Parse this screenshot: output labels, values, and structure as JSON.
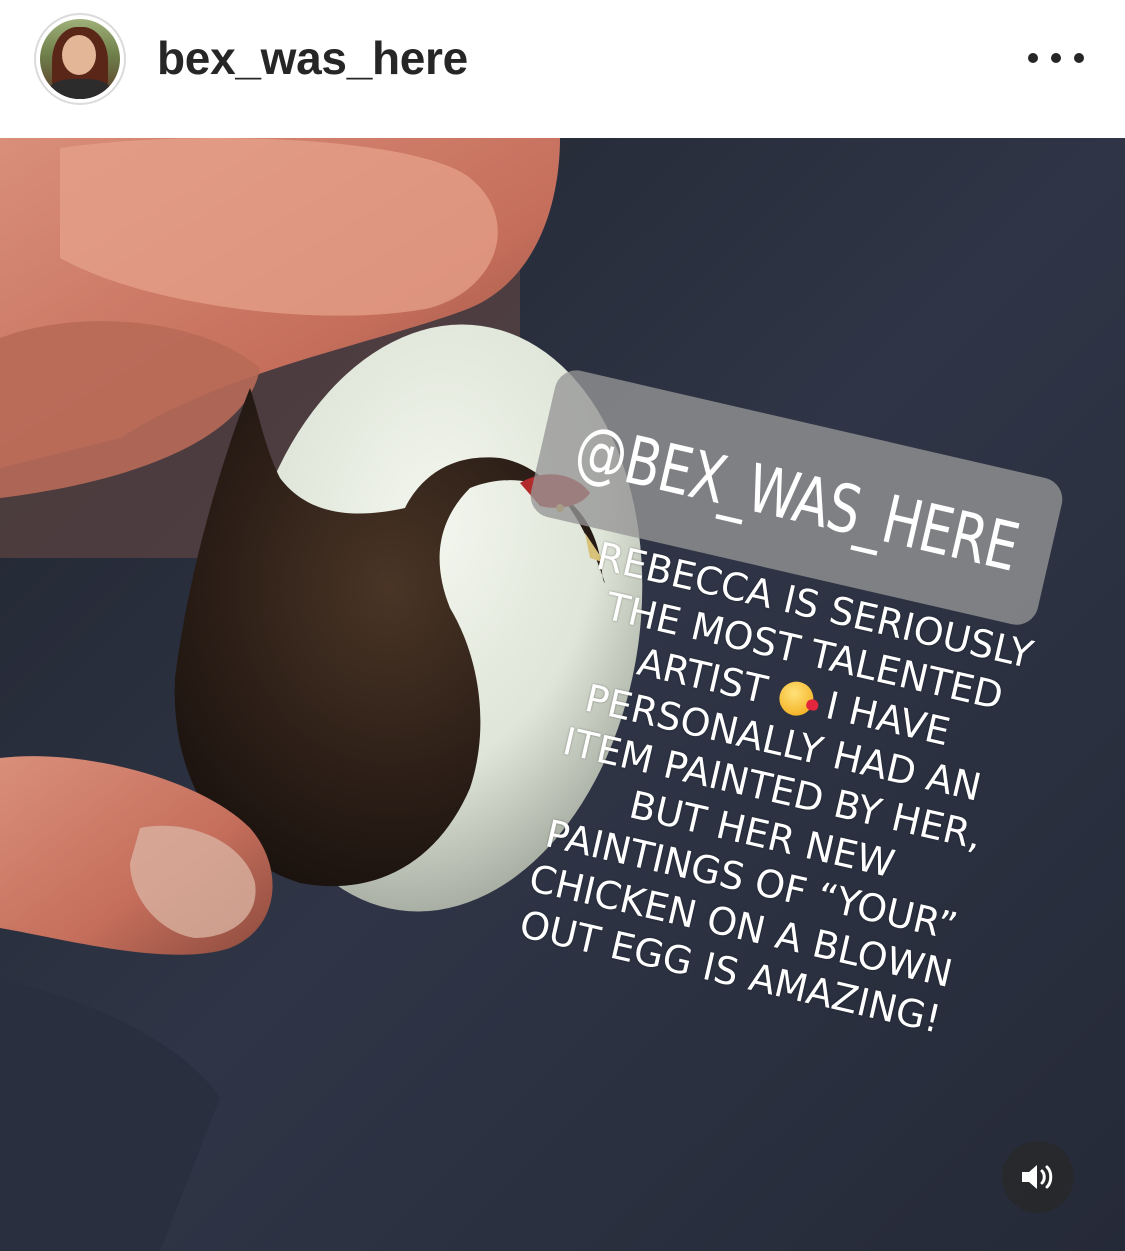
{
  "post": {
    "username": "bex_was_here",
    "more_icon": "more-dots-icon"
  },
  "media": {
    "mention_sticker": "@BEX_WAS_HERE",
    "caption_lines": [
      "REBECCA IS SERIOUSLY",
      "THE MOST TALENTED",
      "ARTIST",
      "I HAVE",
      "PERSONALLY HAD AN",
      "ITEM PAINTED BY HER,",
      "BUT HER NEW",
      "PAINTINGS OF “YOUR”",
      "CHICKEN ON A BLOWN",
      "OUT EGG IS AMAZING!"
    ],
    "emoji_icon": "smiling-face-with-hearts-icon",
    "volume_icon": "speaker-icon"
  },
  "colors": {
    "username": "#262626",
    "denim": "#2b3040",
    "sticker_bg": "#969696"
  }
}
